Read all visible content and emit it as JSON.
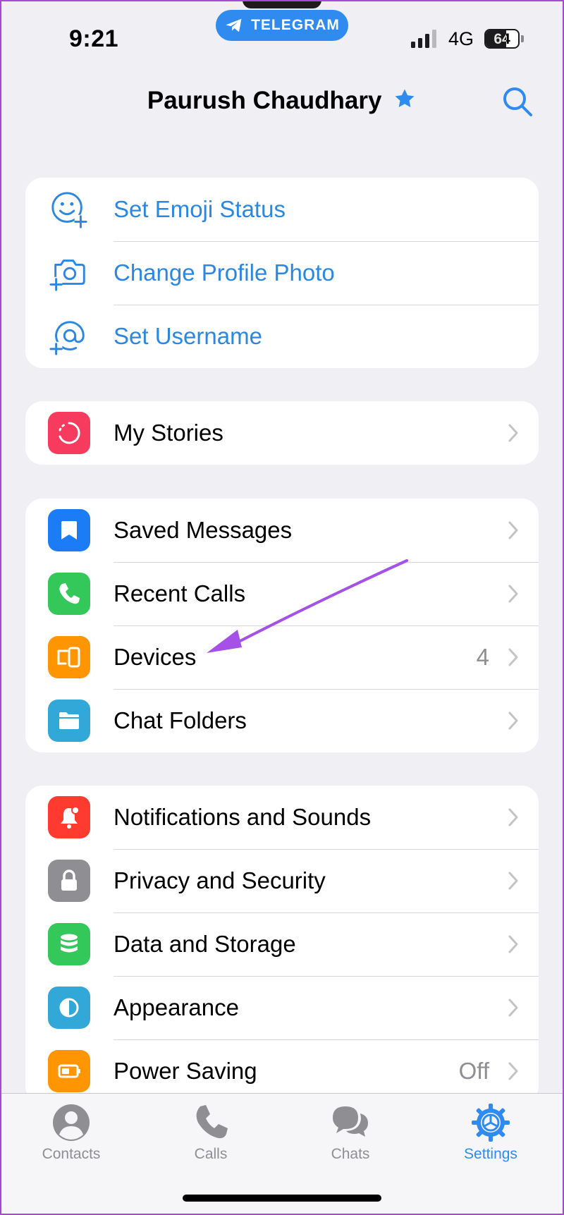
{
  "status_bar": {
    "time": "9:21",
    "app_pill": "TELEGRAM",
    "network": "4G",
    "battery": "64",
    "battery_level": 0.64
  },
  "header": {
    "title": "Paurush Chaudhary"
  },
  "profile_actions": [
    {
      "label": "Set Emoji Status",
      "icon": "emoji-plus-icon"
    },
    {
      "label": "Change Profile Photo",
      "icon": "camera-plus-icon"
    },
    {
      "label": "Set Username",
      "icon": "at-plus-icon"
    }
  ],
  "stories": [
    {
      "label": "My Stories",
      "icon": "stories-icon",
      "color": "#f73b5f"
    }
  ],
  "main_group": [
    {
      "label": "Saved Messages",
      "icon": "bookmark-icon",
      "color": "#1b7cf5"
    },
    {
      "label": "Recent Calls",
      "icon": "phone-icon",
      "color": "#34c759"
    },
    {
      "label": "Devices",
      "value": "4",
      "icon": "devices-icon",
      "color": "#ff9500"
    },
    {
      "label": "Chat Folders",
      "icon": "folder-icon",
      "color": "#32a8d8"
    }
  ],
  "settings_group": [
    {
      "label": "Notifications and Sounds",
      "icon": "bell-icon",
      "color": "#ff3b30"
    },
    {
      "label": "Privacy and Security",
      "icon": "lock-icon",
      "color": "#8e8e93"
    },
    {
      "label": "Data and Storage",
      "icon": "database-icon",
      "color": "#34c759"
    },
    {
      "label": "Appearance",
      "icon": "half-circle-icon",
      "color": "#32a8d8"
    },
    {
      "label": "Power Saving",
      "value": "Off",
      "icon": "battery-icon",
      "color": "#ff9500"
    }
  ],
  "tabbar": {
    "contacts": "Contacts",
    "calls": "Calls",
    "chats": "Chats",
    "settings": "Settings"
  },
  "colors": {
    "accent": "#2f8bf0",
    "annotation_arrow": "#a550e6",
    "background": "#efeff4"
  }
}
